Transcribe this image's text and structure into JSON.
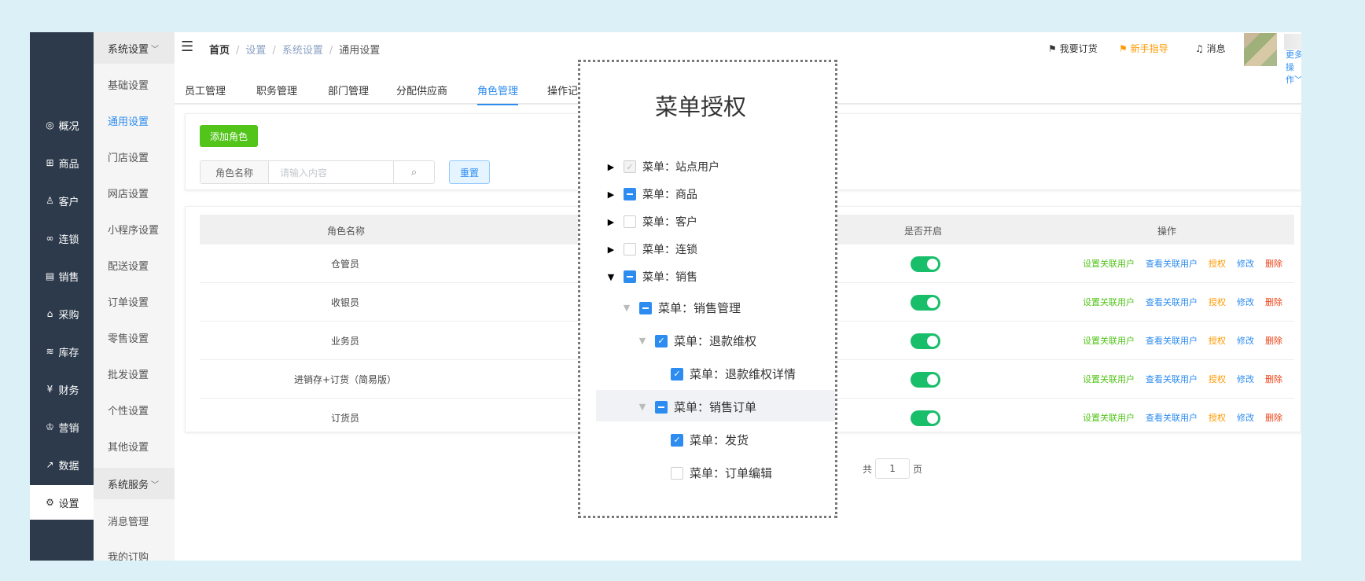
{
  "leftnav": {
    "items": [
      {
        "icon": "compass",
        "label": "概况"
      },
      {
        "icon": "grid",
        "label": "商品"
      },
      {
        "icon": "user",
        "label": "客户"
      },
      {
        "icon": "link",
        "label": "连锁"
      },
      {
        "icon": "receipt",
        "label": "销售"
      },
      {
        "icon": "bag",
        "label": "采购"
      },
      {
        "icon": "layers",
        "label": "库存"
      },
      {
        "icon": "yen",
        "label": "财务"
      },
      {
        "icon": "crown",
        "label": "营销"
      },
      {
        "icon": "chart-line",
        "label": "数据"
      },
      {
        "icon": "gear",
        "label": "设置"
      }
    ],
    "active_index": 10
  },
  "subnav": {
    "group1": "系统设置",
    "items": [
      "基础设置",
      "通用设置",
      "门店设置",
      "网店设置",
      "小程序设置",
      "配送设置",
      "订单设置",
      "零售设置",
      "批发设置",
      "个性设置",
      "其他设置"
    ],
    "active_index": 1,
    "group2": "系统服务",
    "items2": [
      "消息管理",
      "我的订购"
    ]
  },
  "breadcrumb": {
    "home": "首页",
    "c1": "设置",
    "c2": "系统设置",
    "current": "通用设置"
  },
  "topbar": {
    "order": "我要订货",
    "guide": "新手指导",
    "messages": "消息",
    "more": "更多操作"
  },
  "tabs": [
    "员工管理",
    "职务管理",
    "部门管理",
    "分配供应商",
    "角色管理",
    "操作记"
  ],
  "active_tab": 4,
  "toolbar": {
    "add_role": "添加角色",
    "search_label": "角色名称",
    "search_placeholder": "请输入内容",
    "reset": "重置"
  },
  "table": {
    "headers": {
      "name": "角色名称",
      "enabled": "是否开启",
      "actions": "操作"
    },
    "rows": [
      {
        "name": "仓管员",
        "enabled": true
      },
      {
        "name": "收银员",
        "enabled": true
      },
      {
        "name": "业务员",
        "enabled": true
      },
      {
        "name": "进销存+订货（简易版）",
        "enabled": true
      },
      {
        "name": "订货员",
        "enabled": true
      }
    ],
    "actions": [
      "设置关联用户",
      "查看关联用户",
      "授权",
      "修改",
      "删除"
    ]
  },
  "pager": {
    "prefix": "共",
    "page": "1",
    "suffix": "页"
  },
  "modal": {
    "title": "菜单授权",
    "nodes": [
      {
        "label": "菜单：站点用户",
        "arrow": "collapsed",
        "check": "disabled"
      },
      {
        "label": "菜单：商品",
        "arrow": "collapsed",
        "check": "half"
      },
      {
        "label": "菜单：客户",
        "arrow": "collapsed",
        "check": "none"
      },
      {
        "label": "菜单：连锁",
        "arrow": "collapsed",
        "check": "none"
      },
      {
        "label": "菜单：销售",
        "arrow": "expanded",
        "check": "half"
      },
      {
        "label": "菜单：销售管理",
        "arrow": "expanded-grey",
        "check": "half"
      },
      {
        "label": "菜单：退款维权",
        "arrow": "expanded-grey",
        "check": "checked"
      },
      {
        "label": "菜单：退款维权详情",
        "arrow": "none",
        "check": "checked"
      },
      {
        "label": "菜单：销售订单",
        "arrow": "expanded-grey",
        "check": "half"
      },
      {
        "label": "菜单：发货",
        "arrow": "none",
        "check": "checked"
      },
      {
        "label": "菜单：订单编辑",
        "arrow": "none",
        "check": "none"
      }
    ]
  }
}
